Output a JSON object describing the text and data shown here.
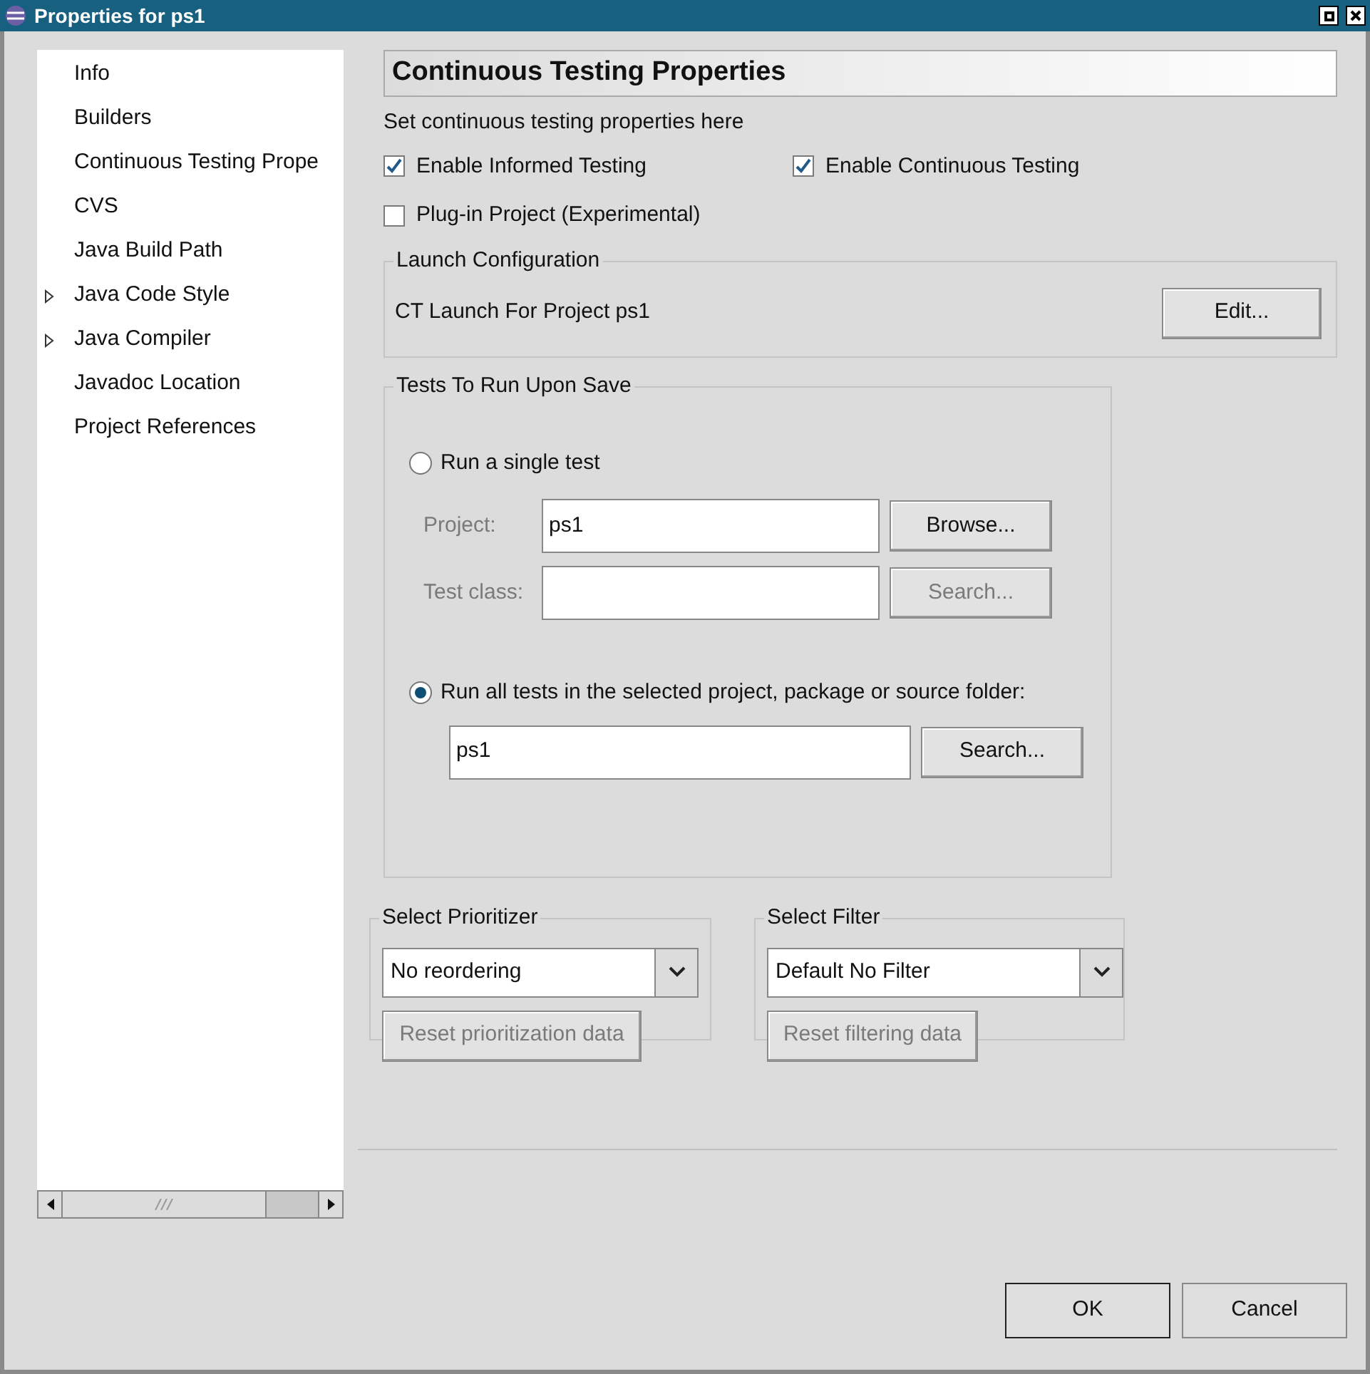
{
  "window": {
    "title": "Properties for ps1"
  },
  "sidebar": {
    "items": [
      {
        "label": "Info",
        "expandable": false,
        "selected": false
      },
      {
        "label": "Builders",
        "expandable": false,
        "selected": false
      },
      {
        "label": "Continuous Testing Prope",
        "expandable": false,
        "selected": false
      },
      {
        "label": "CVS",
        "expandable": false,
        "selected": false
      },
      {
        "label": "Java Build Path",
        "expandable": false,
        "selected": false
      },
      {
        "label": "Java Code Style",
        "expandable": true,
        "selected": false
      },
      {
        "label": "Java Compiler",
        "expandable": true,
        "selected": false
      },
      {
        "label": "Javadoc Location",
        "expandable": false,
        "selected": false
      },
      {
        "label": "Project References",
        "expandable": false,
        "selected": false
      }
    ]
  },
  "page": {
    "title": "Continuous Testing Properties",
    "description": "Set continuous testing properties here",
    "checkboxes": [
      {
        "label": "Enable Informed Testing",
        "checked": true
      },
      {
        "label": "Enable Continuous Testing",
        "checked": true
      },
      {
        "label": "Plug-in Project (Experimental)",
        "checked": false
      }
    ],
    "launch": {
      "title": "Launch Configuration",
      "text": "CT Launch For Project ps1",
      "button": "Edit..."
    },
    "tests": {
      "title": "Tests To Run Upon Save",
      "single": {
        "label": "Run a single test",
        "selected": false,
        "project_label": "Project:",
        "project_value": "ps1",
        "browse": "Browse...",
        "class_label": "Test class:",
        "class_search": "Search..."
      },
      "all": {
        "label": "Run all tests in the selected project, package or source folder:",
        "selected": true,
        "value": "ps1",
        "search": "Search..."
      }
    },
    "prioritizer": {
      "title": "Select Prioritizer",
      "value": "No reordering",
      "button": "Reset prioritization data"
    },
    "filter": {
      "title": "Select Filter",
      "value": "Default No Filter",
      "button": "Reset filtering data"
    }
  },
  "buttons": [
    "OK",
    "Cancel"
  ]
}
